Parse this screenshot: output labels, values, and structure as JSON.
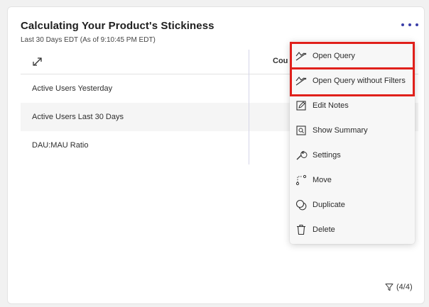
{
  "card": {
    "title": "Calculating Your Product's Stickiness",
    "subtitle": "Last 30 Days EDT (As of 9:10:45 PM EDT)",
    "more_icon": "more-horizontal-icon",
    "accent_color": "#3b3fa8"
  },
  "table": {
    "sort_icon": "swap-arrows-icon",
    "count_header": "Cou",
    "rows": [
      {
        "label": "Active Users Yesterday"
      },
      {
        "label": "Active Users Last 30 Days"
      },
      {
        "label": "DAU:MAU Ratio"
      }
    ]
  },
  "menu": {
    "items": [
      {
        "label": "Open Query",
        "icon": "chart-line-icon"
      },
      {
        "label": "Open Query without Filters",
        "icon": "chart-line-icon"
      },
      {
        "label": "Edit Notes",
        "icon": "edit-icon"
      },
      {
        "label": "Show Summary",
        "icon": "summary-icon"
      },
      {
        "label": "Settings",
        "icon": "wrench-icon"
      },
      {
        "label": "Move",
        "icon": "move-icon"
      },
      {
        "label": "Duplicate",
        "icon": "duplicate-icon"
      },
      {
        "label": "Delete",
        "icon": "trash-icon"
      }
    ],
    "highlight_color": "#e0201b"
  },
  "footer": {
    "filter_count": "(4/4)",
    "filter_icon": "filter-icon"
  }
}
